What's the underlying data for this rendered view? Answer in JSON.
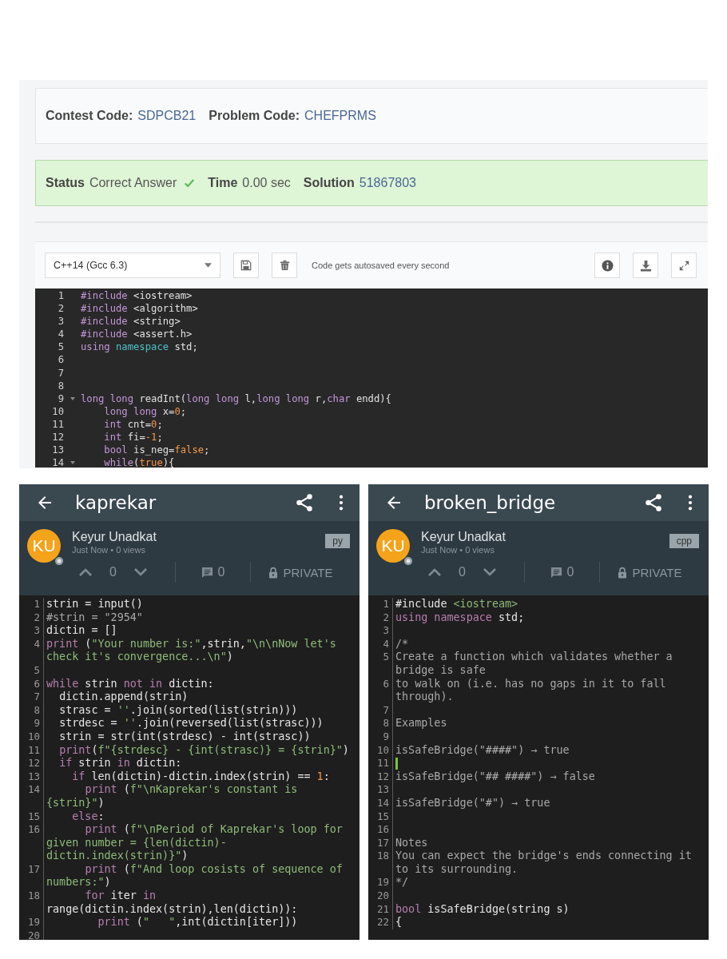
{
  "problem": {
    "contest_label": "Contest Code:",
    "contest_code": "SDPCB21",
    "problem_label": "Problem Code:",
    "problem_code": "CHEFPRMS"
  },
  "result": {
    "status_label": "Status",
    "status": "Correct Answer",
    "time_label": "Time",
    "time": "0.00 sec",
    "solution_label": "Solution",
    "solution": "51867803"
  },
  "toolbar": {
    "language": "C++14 (Gcc 6.3)",
    "note": "Code gets autosaved every second"
  },
  "editor": {
    "lines": [
      {
        "n": "1",
        "fold": false,
        "c": [
          {
            "text": "#include",
            "kind": "kw"
          },
          {
            "text": " <iostream>",
            "kind": "pl"
          }
        ]
      },
      {
        "n": "2",
        "fold": false,
        "c": [
          {
            "text": "#include",
            "kind": "kw"
          },
          {
            "text": " <algorithm>",
            "kind": "pl"
          }
        ]
      },
      {
        "n": "3",
        "fold": false,
        "c": [
          {
            "text": "#include",
            "kind": "kw"
          },
          {
            "text": " <string>",
            "kind": "pl"
          }
        ]
      },
      {
        "n": "4",
        "fold": false,
        "c": [
          {
            "text": "#include",
            "kind": "kw"
          },
          {
            "text": " <assert.h>",
            "kind": "pl"
          }
        ]
      },
      {
        "n": "5",
        "fold": false,
        "c": [
          {
            "text": "using",
            "kind": "kw"
          },
          {
            "text": " namespace",
            "kind": "ty"
          },
          {
            "text": " std;",
            "kind": "pl"
          }
        ]
      },
      {
        "n": "6",
        "fold": false
      },
      {
        "n": "7",
        "fold": false
      },
      {
        "n": "8",
        "fold": false
      },
      {
        "n": "9",
        "fold": true,
        "c": [
          {
            "text": "long long",
            "kind": "kw"
          },
          {
            "text": " readInt(",
            "kind": "pl"
          },
          {
            "text": "long long",
            "kind": "kw"
          },
          {
            "text": " l,",
            "kind": "pl"
          },
          {
            "text": "long long",
            "kind": "kw"
          },
          {
            "text": " r,",
            "kind": "pl"
          },
          {
            "text": "char",
            "kind": "kw"
          },
          {
            "text": " endd){",
            "kind": "pl"
          }
        ]
      },
      {
        "n": "10",
        "fold": false,
        "c": [
          {
            "text": "    long long",
            "kind": "kw"
          },
          {
            "text": " x=",
            "kind": "pl"
          },
          {
            "text": "0",
            "kind": "num"
          },
          {
            "text": ";",
            "kind": "pl"
          }
        ]
      },
      {
        "n": "11",
        "fold": false,
        "c": [
          {
            "text": "    int",
            "kind": "kw"
          },
          {
            "text": " cnt=",
            "kind": "pl"
          },
          {
            "text": "0",
            "kind": "num"
          },
          {
            "text": ";",
            "kind": "pl"
          }
        ]
      },
      {
        "n": "12",
        "fold": false,
        "c": [
          {
            "text": "    int",
            "kind": "kw"
          },
          {
            "text": " fi=",
            "kind": "pl"
          },
          {
            "text": "-1",
            "kind": "num"
          },
          {
            "text": ";",
            "kind": "pl"
          }
        ]
      },
      {
        "n": "13",
        "fold": false,
        "c": [
          {
            "text": "    bool",
            "kind": "kw"
          },
          {
            "text": " is_neg=",
            "kind": "pl"
          },
          {
            "text": "false",
            "kind": "num"
          },
          {
            "text": ";",
            "kind": "pl"
          }
        ]
      },
      {
        "n": "14",
        "fold": true,
        "c": [
          {
            "text": "    while",
            "kind": "kw"
          },
          {
            "text": "(",
            "kind": "pl"
          },
          {
            "text": "true",
            "kind": "num"
          },
          {
            "text": "){",
            "kind": "pl"
          }
        ]
      }
    ]
  },
  "apps": [
    {
      "title": "kaprekar",
      "initials": "KU",
      "author": "Keyur Unadkat",
      "meta": "Just Now • 0 views",
      "language": "py",
      "votes": "0",
      "comments": "0",
      "visibility": "PRIVATE",
      "lines": [
        {
          "n": "1",
          "cursor": false,
          "c": [
            {
              "text": "strin = input()",
              "kind": "pl"
            }
          ]
        },
        {
          "n": "2",
          "cursor": false,
          "c": [
            {
              "text": "#strin = \"2954\"",
              "kind": "com"
            }
          ]
        },
        {
          "n": "3",
          "cursor": false,
          "c": [
            {
              "text": "dictin = []",
              "kind": "pl"
            }
          ]
        },
        {
          "n": "4",
          "cursor": false,
          "c": [
            {
              "text": "print",
              "kind": "kw"
            },
            {
              "text": " (",
              "kind": "pl"
            },
            {
              "text": "\"Your number is:\"",
              "kind": "str"
            },
            {
              "text": ",strin,",
              "kind": "pl"
            },
            {
              "text": "\"\\n\\nNow let's check it's convergence...\\n\"",
              "kind": "str"
            },
            {
              "text": ")",
              "kind": "pl"
            }
          ]
        },
        {
          "n": "5",
          "cursor": false
        },
        {
          "n": "6",
          "cursor": false,
          "c": [
            {
              "text": "while",
              "kind": "kw"
            },
            {
              "text": " strin ",
              "kind": "pl"
            },
            {
              "text": "not in",
              "kind": "kw"
            },
            {
              "text": " dictin:",
              "kind": "pl"
            }
          ]
        },
        {
          "n": "7",
          "cursor": false,
          "c": [
            {
              "text": "  dictin.append(strin)",
              "kind": "pl"
            }
          ]
        },
        {
          "n": "8",
          "cursor": false,
          "c": [
            {
              "text": "  strasc = ",
              "kind": "pl"
            },
            {
              "text": "''",
              "kind": "str"
            },
            {
              "text": ".join(sorted(list(strin)))",
              "kind": "pl"
            }
          ]
        },
        {
          "n": "9",
          "cursor": false,
          "c": [
            {
              "text": "  strdesc = ",
              "kind": "pl"
            },
            {
              "text": "''",
              "kind": "str"
            },
            {
              "text": ".join(reversed(list(strasc)))",
              "kind": "pl"
            }
          ]
        },
        {
          "n": "10",
          "cursor": false,
          "c": [
            {
              "text": "  strin = str(int(strdesc) - int(strasc))",
              "kind": "pl"
            }
          ]
        },
        {
          "n": "11",
          "cursor": false,
          "c": [
            {
              "text": "  print",
              "kind": "kw"
            },
            {
              "text": "(",
              "kind": "pl"
            },
            {
              "text": "f\"{strdesc} - {int(strasc)} = {strin}\"",
              "kind": "str"
            },
            {
              "text": ")",
              "kind": "pl"
            }
          ]
        },
        {
          "n": "12",
          "cursor": false,
          "c": [
            {
              "text": "  if",
              "kind": "kw"
            },
            {
              "text": " strin ",
              "kind": "pl"
            },
            {
              "text": "in",
              "kind": "kw"
            },
            {
              "text": " dictin:",
              "kind": "pl"
            }
          ]
        },
        {
          "n": "13",
          "cursor": false,
          "c": [
            {
              "text": "    if",
              "kind": "kw"
            },
            {
              "text": " len(dictin)-dictin.index(strin) == ",
              "kind": "pl"
            },
            {
              "text": "1",
              "kind": "num"
            },
            {
              "text": ":",
              "kind": "pl"
            }
          ]
        },
        {
          "n": "14",
          "cursor": false,
          "c": [
            {
              "text": "      print",
              "kind": "kw"
            },
            {
              "text": " (",
              "kind": "pl"
            },
            {
              "text": "f\"\\nKaprekar's constant is {strin}\"",
              "kind": "str"
            },
            {
              "text": ")",
              "kind": "pl"
            }
          ]
        },
        {
          "n": "15",
          "cursor": false,
          "c": [
            {
              "text": "    else",
              "kind": "kw"
            },
            {
              "text": ":",
              "kind": "pl"
            }
          ]
        },
        {
          "n": "16",
          "cursor": false,
          "c": [
            {
              "text": "      print",
              "kind": "kw"
            },
            {
              "text": " (",
              "kind": "pl"
            },
            {
              "text": "f\"\\nPeriod of Kaprekar's loop for given number = {len(dictin)-dictin.index(strin)}\"",
              "kind": "str"
            },
            {
              "text": ")",
              "kind": "pl"
            }
          ]
        },
        {
          "n": "17",
          "cursor": false,
          "c": [
            {
              "text": "      print",
              "kind": "kw"
            },
            {
              "text": " (",
              "kind": "pl"
            },
            {
              "text": "f\"And loop cosists of sequence of numbers:\"",
              "kind": "str"
            },
            {
              "text": ")",
              "kind": "pl"
            }
          ]
        },
        {
          "n": "18",
          "cursor": false,
          "c": [
            {
              "text": "      for",
              "kind": "kw"
            },
            {
              "text": " iter ",
              "kind": "pl"
            },
            {
              "text": "in",
              "kind": "kw"
            },
            {
              "text": " range(dictin.index(strin),len(dictin)):",
              "kind": "pl"
            }
          ]
        },
        {
          "n": "19",
          "cursor": false,
          "c": [
            {
              "text": "        print",
              "kind": "kw"
            },
            {
              "text": " (",
              "kind": "pl"
            },
            {
              "text": "\"   \"",
              "kind": "str"
            },
            {
              "text": ",int(dictin[iter]))",
              "kind": "pl"
            }
          ]
        },
        {
          "n": "20",
          "cursor": false
        }
      ]
    },
    {
      "title": "broken_bridge",
      "initials": "KU",
      "author": "Keyur Unadkat",
      "meta": "Just Now • 0 views",
      "language": "cpp",
      "votes": "0",
      "comments": "0",
      "visibility": "PRIVATE",
      "lines": [
        {
          "n": "1",
          "cursor": false,
          "c": [
            {
              "text": "#include ",
              "kind": "pl"
            },
            {
              "text": "<iostream>",
              "kind": "str"
            }
          ]
        },
        {
          "n": "2",
          "cursor": false,
          "c": [
            {
              "text": "using namespace",
              "kind": "kw"
            },
            {
              "text": " std;",
              "kind": "pl"
            }
          ]
        },
        {
          "n": "3",
          "cursor": false
        },
        {
          "n": "4",
          "cursor": false,
          "c": [
            {
              "text": "/*",
              "kind": "com"
            }
          ]
        },
        {
          "n": "5",
          "cursor": false,
          "c": [
            {
              "text": "Create a function which validates whether a bridge is safe",
              "kind": "com"
            }
          ]
        },
        {
          "n": "6",
          "cursor": false,
          "c": [
            {
              "text": "to walk on (i.e. has no gaps in it to fall through).",
              "kind": "com"
            }
          ]
        },
        {
          "n": "7",
          "cursor": false
        },
        {
          "n": "8",
          "cursor": false,
          "c": [
            {
              "text": "Examples",
              "kind": "com"
            }
          ]
        },
        {
          "n": "9",
          "cursor": false
        },
        {
          "n": "10",
          "cursor": false,
          "c": [
            {
              "text": "isSafeBridge(\"####\") → true",
              "kind": "com"
            }
          ]
        },
        {
          "n": "11",
          "cursor": true
        },
        {
          "n": "12",
          "cursor": false,
          "c": [
            {
              "text": "isSafeBridge(\"## ####\") → false",
              "kind": "com"
            }
          ]
        },
        {
          "n": "13",
          "cursor": false
        },
        {
          "n": "14",
          "cursor": false,
          "c": [
            {
              "text": "isSafeBridge(\"#\") → true",
              "kind": "com"
            }
          ]
        },
        {
          "n": "15",
          "cursor": false
        },
        {
          "n": "16",
          "cursor": false
        },
        {
          "n": "17",
          "cursor": false,
          "c": [
            {
              "text": "Notes",
              "kind": "com"
            }
          ]
        },
        {
          "n": "18",
          "cursor": false,
          "c": [
            {
              "text": "You can expect the bridge's ends connecting it to its surrounding.",
              "kind": "com"
            }
          ]
        },
        {
          "n": "19",
          "cursor": false,
          "c": [
            {
              "text": "*/",
              "kind": "com"
            }
          ]
        },
        {
          "n": "20",
          "cursor": false
        },
        {
          "n": "21",
          "cursor": false,
          "c": [
            {
              "text": "bool",
              "kind": "kw"
            },
            {
              "text": " isSafeBridge(string s)",
              "kind": "pl"
            }
          ]
        },
        {
          "n": "22",
          "cursor": false,
          "c": [
            {
              "text": "{",
              "kind": "pl"
            }
          ]
        }
      ]
    }
  ]
}
